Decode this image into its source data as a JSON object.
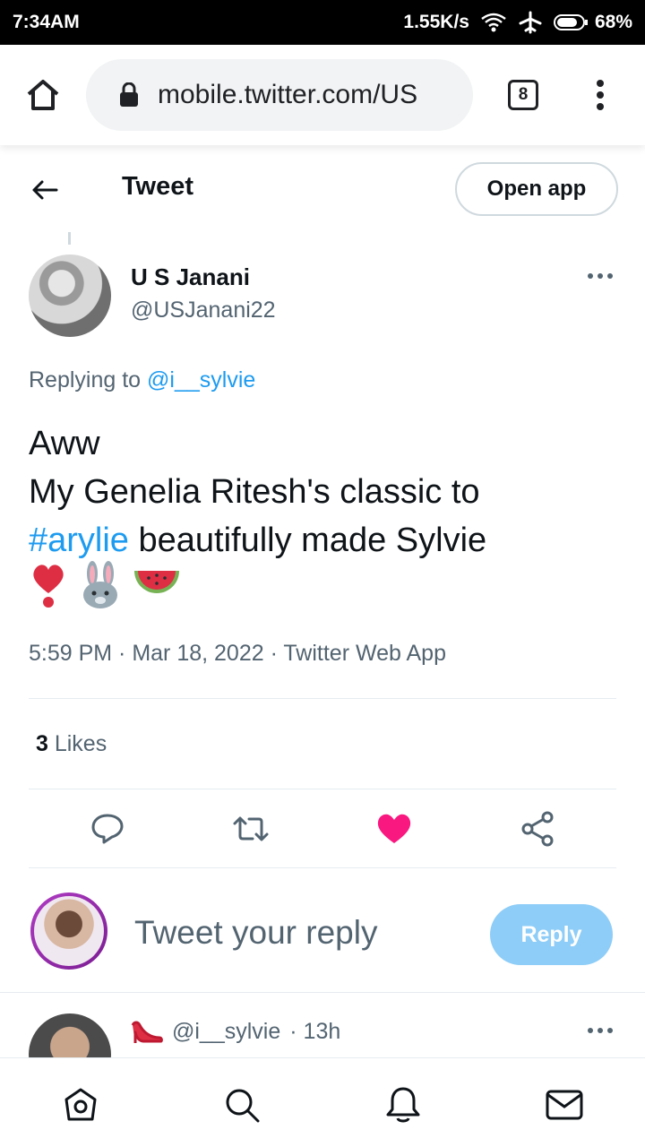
{
  "status_bar": {
    "time": "7:34AM",
    "network_speed": "1.55K/s",
    "battery": "68%",
    "icons": [
      "wifi-icon",
      "airplane-icon",
      "battery-icon"
    ]
  },
  "browser": {
    "url": "mobile.twitter.com/US",
    "tab_count": "8"
  },
  "header": {
    "title": "Tweet",
    "open_app_label": "Open app"
  },
  "tweet": {
    "author_name": "U S Janani",
    "author_handle": "@USJanani22",
    "replying_prefix": "Replying to",
    "replying_to": "@i__sylvie",
    "text_line1": "Aww",
    "text_line2": "My Genelia Ritesh's classic to",
    "hashtag": "#arylie",
    "text_line3_rest": " beautifully made Sylvie",
    "emojis": [
      "❣",
      "🐰",
      "🍉"
    ],
    "meta": "5:59 PM · Mar 18, 2022 · Twitter Web App",
    "likes_count": "3",
    "likes_label": " Likes",
    "liked": true
  },
  "composer": {
    "placeholder": "Tweet your reply",
    "reply_label": "Reply"
  },
  "next_reply": {
    "handle": "@i__sylvie",
    "time": "· 13h"
  },
  "colors": {
    "accent": "#1d9bf0",
    "like": "#f91880",
    "reply_button": "#8ecdf7",
    "secondary_text": "#536471"
  }
}
